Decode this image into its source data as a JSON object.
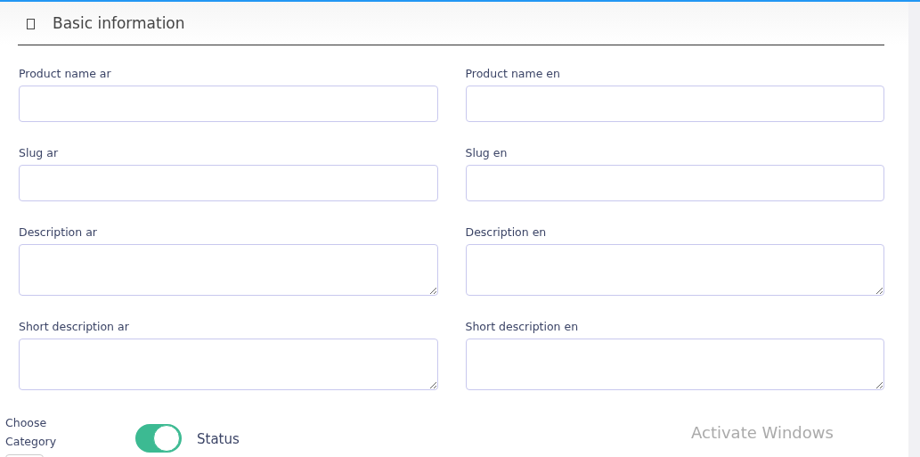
{
  "section": {
    "title": "Basic information"
  },
  "fields": [
    {
      "label": "Product name ar",
      "kind": "input"
    },
    {
      "label": "Product name en",
      "kind": "input"
    },
    {
      "label": "Slug ar",
      "kind": "input"
    },
    {
      "label": "Slug en",
      "kind": "input"
    },
    {
      "label": "Description ar",
      "kind": "textarea"
    },
    {
      "label": "Description en",
      "kind": "textarea"
    },
    {
      "label": "Short description ar",
      "kind": "textarea"
    },
    {
      "label": "Short description en",
      "kind": "textarea"
    }
  ],
  "category": {
    "label": "Choose Category"
  },
  "status": {
    "label": "Status",
    "on": true
  },
  "os_notice": {
    "title": "Activate Windows"
  }
}
